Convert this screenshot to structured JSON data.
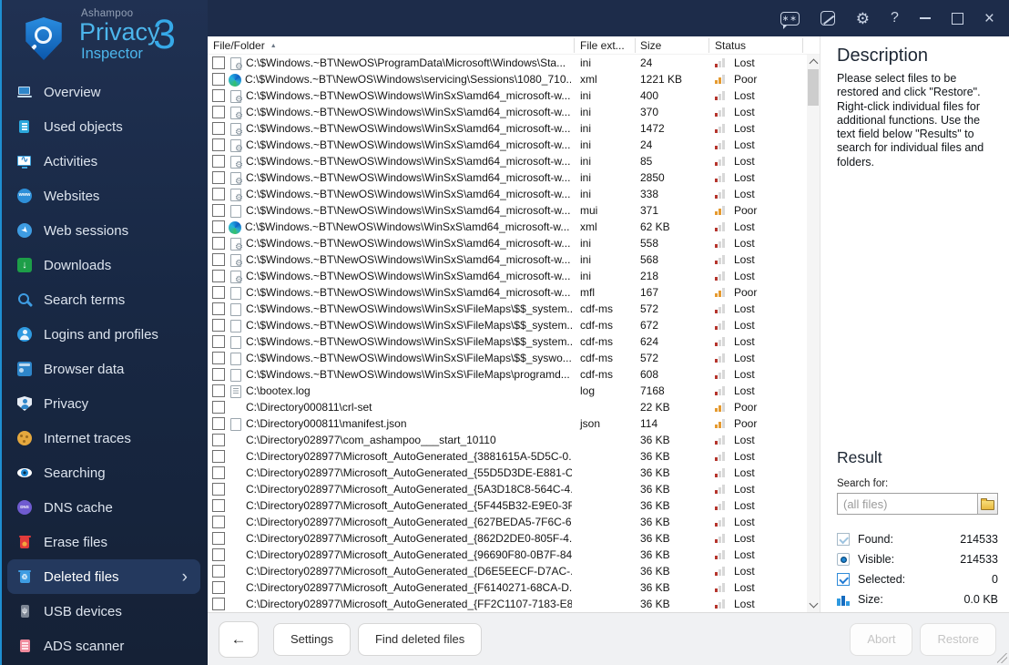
{
  "app": {
    "brand": "Ashampoo",
    "name_line1": "Privacy",
    "name_line2": "Inspector",
    "version": "3"
  },
  "colors": {
    "accent": "#36a9e8",
    "titlebar_bg": "#1d2c4a",
    "sidebar_bg": "#182844",
    "selected_item_bg": "#24395e",
    "status_lost": "#b5342c",
    "status_poor": "#e59a2f"
  },
  "titlebar": {
    "chat_glyph": "∗∗",
    "help_glyph": "?",
    "close_glyph": "×"
  },
  "sidebar": {
    "items": [
      {
        "label": "Overview",
        "icon": "ic-overview",
        "glyph": ""
      },
      {
        "label": "Used objects",
        "icon": "ic-used",
        "glyph": ""
      },
      {
        "label": "Activities",
        "icon": "ic-activities",
        "glyph": "∿"
      },
      {
        "label": "Websites",
        "icon": "ic-websites",
        "glyph": "www"
      },
      {
        "label": "Web sessions",
        "icon": "ic-websessions",
        "glyph": "➤"
      },
      {
        "label": "Downloads",
        "icon": "ic-downloads",
        "glyph": "↓"
      },
      {
        "label": "Search terms",
        "icon": "ic-search",
        "glyph": ""
      },
      {
        "label": "Logins and profiles",
        "icon": "ic-logins",
        "glyph": ""
      },
      {
        "label": "Browser data",
        "icon": "ic-browser",
        "glyph": ""
      },
      {
        "label": "Privacy",
        "icon": "ic-privacy",
        "glyph": ""
      },
      {
        "label": "Internet traces",
        "icon": "ic-traces",
        "glyph": ""
      },
      {
        "label": "Searching",
        "icon": "ic-eye",
        "glyph": ""
      },
      {
        "label": "DNS cache",
        "icon": "ic-dns",
        "glyph": "DNS"
      },
      {
        "label": "Erase files",
        "icon": "ic-erase",
        "glyph": ""
      },
      {
        "label": "Deleted files",
        "icon": "ic-deleted",
        "glyph": "♲",
        "state": "selected",
        "chevron": "›"
      },
      {
        "label": "USB devices",
        "icon": "ic-usb",
        "glyph": "ψ"
      },
      {
        "label": "ADS scanner",
        "icon": "ic-ads",
        "glyph": ""
      }
    ]
  },
  "table": {
    "columns": {
      "file": "File/Folder",
      "ext": "File ext...",
      "size": "Size",
      "status": "Status"
    },
    "sort_indicator": "▲",
    "rows": [
      {
        "path": "C:\\$Windows.~BT\\NewOS\\ProgramData\\Microsoft\\Windows\\Sta...",
        "ext": "ini",
        "size": "24",
        "status": "Lost",
        "icon": "gear"
      },
      {
        "path": "C:\\$Windows.~BT\\NewOS\\Windows\\servicing\\Sessions\\1080_710...",
        "ext": "xml",
        "size": "1221 KB",
        "status": "Poor",
        "icon": "edge"
      },
      {
        "path": "C:\\$Windows.~BT\\NewOS\\Windows\\WinSxS\\amd64_microsoft-w...",
        "ext": "ini",
        "size": "400",
        "status": "Lost",
        "icon": "gear"
      },
      {
        "path": "C:\\$Windows.~BT\\NewOS\\Windows\\WinSxS\\amd64_microsoft-w...",
        "ext": "ini",
        "size": "370",
        "status": "Lost",
        "icon": "gear"
      },
      {
        "path": "C:\\$Windows.~BT\\NewOS\\Windows\\WinSxS\\amd64_microsoft-w...",
        "ext": "ini",
        "size": "1472",
        "status": "Lost",
        "icon": "gear"
      },
      {
        "path": "C:\\$Windows.~BT\\NewOS\\Windows\\WinSxS\\amd64_microsoft-w...",
        "ext": "ini",
        "size": "24",
        "status": "Lost",
        "icon": "gear"
      },
      {
        "path": "C:\\$Windows.~BT\\NewOS\\Windows\\WinSxS\\amd64_microsoft-w...",
        "ext": "ini",
        "size": "85",
        "status": "Lost",
        "icon": "gear"
      },
      {
        "path": "C:\\$Windows.~BT\\NewOS\\Windows\\WinSxS\\amd64_microsoft-w...",
        "ext": "ini",
        "size": "2850",
        "status": "Lost",
        "icon": "gear"
      },
      {
        "path": "C:\\$Windows.~BT\\NewOS\\Windows\\WinSxS\\amd64_microsoft-w...",
        "ext": "ini",
        "size": "338",
        "status": "Lost",
        "icon": "gear"
      },
      {
        "path": "C:\\$Windows.~BT\\NewOS\\Windows\\WinSxS\\amd64_microsoft-w...",
        "ext": "mui",
        "size": "371",
        "status": "Poor",
        "icon": "doc"
      },
      {
        "path": "C:\\$Windows.~BT\\NewOS\\Windows\\WinSxS\\amd64_microsoft-w...",
        "ext": "xml",
        "size": "62 KB",
        "status": "Lost",
        "icon": "edge"
      },
      {
        "path": "C:\\$Windows.~BT\\NewOS\\Windows\\WinSxS\\amd64_microsoft-w...",
        "ext": "ini",
        "size": "558",
        "status": "Lost",
        "icon": "gear"
      },
      {
        "path": "C:\\$Windows.~BT\\NewOS\\Windows\\WinSxS\\amd64_microsoft-w...",
        "ext": "ini",
        "size": "568",
        "status": "Lost",
        "icon": "gear"
      },
      {
        "path": "C:\\$Windows.~BT\\NewOS\\Windows\\WinSxS\\amd64_microsoft-w...",
        "ext": "ini",
        "size": "218",
        "status": "Lost",
        "icon": "gear"
      },
      {
        "path": "C:\\$Windows.~BT\\NewOS\\Windows\\WinSxS\\amd64_microsoft-w...",
        "ext": "mfl",
        "size": "167",
        "status": "Poor",
        "icon": "doc"
      },
      {
        "path": "C:\\$Windows.~BT\\NewOS\\Windows\\WinSxS\\FileMaps\\$$_system...",
        "ext": "cdf-ms",
        "size": "572",
        "status": "Lost",
        "icon": "doc"
      },
      {
        "path": "C:\\$Windows.~BT\\NewOS\\Windows\\WinSxS\\FileMaps\\$$_system...",
        "ext": "cdf-ms",
        "size": "672",
        "status": "Lost",
        "icon": "doc"
      },
      {
        "path": "C:\\$Windows.~BT\\NewOS\\Windows\\WinSxS\\FileMaps\\$$_system...",
        "ext": "cdf-ms",
        "size": "624",
        "status": "Lost",
        "icon": "doc"
      },
      {
        "path": "C:\\$Windows.~BT\\NewOS\\Windows\\WinSxS\\FileMaps\\$$_syswo...",
        "ext": "cdf-ms",
        "size": "572",
        "status": "Lost",
        "icon": "doc"
      },
      {
        "path": "C:\\$Windows.~BT\\NewOS\\Windows\\WinSxS\\FileMaps\\programd...",
        "ext": "cdf-ms",
        "size": "608",
        "status": "Lost",
        "icon": "doc"
      },
      {
        "path": "C:\\bootex.log",
        "ext": "log",
        "size": "7168",
        "status": "Lost",
        "icon": "doclines"
      },
      {
        "path": "C:\\Directory000811\\crl-set",
        "ext": "",
        "size": "22 KB",
        "status": "Poor",
        "icon": "none"
      },
      {
        "path": "C:\\Directory000811\\manifest.json",
        "ext": "json",
        "size": "114",
        "status": "Poor",
        "icon": "doc"
      },
      {
        "path": "C:\\Directory028977\\com_ashampoo___start_10110",
        "ext": "",
        "size": "36 KB",
        "status": "Lost",
        "icon": "none"
      },
      {
        "path": "C:\\Directory028977\\Microsoft_AutoGenerated_{3881615A-5D5C-0...",
        "ext": "",
        "size": "36 KB",
        "status": "Lost",
        "icon": "none"
      },
      {
        "path": "C:\\Directory028977\\Microsoft_AutoGenerated_{55D5D3DE-E881-C...",
        "ext": "",
        "size": "36 KB",
        "status": "Lost",
        "icon": "none"
      },
      {
        "path": "C:\\Directory028977\\Microsoft_AutoGenerated_{5A3D18C8-564C-4...",
        "ext": "",
        "size": "36 KB",
        "status": "Lost",
        "icon": "none"
      },
      {
        "path": "C:\\Directory028977\\Microsoft_AutoGenerated_{5F445B32-E9E0-3F...",
        "ext": "",
        "size": "36 KB",
        "status": "Lost",
        "icon": "none"
      },
      {
        "path": "C:\\Directory028977\\Microsoft_AutoGenerated_{627BEDA5-7F6C-6...",
        "ext": "",
        "size": "36 KB",
        "status": "Lost",
        "icon": "none"
      },
      {
        "path": "C:\\Directory028977\\Microsoft_AutoGenerated_{862D2DE0-805F-4...",
        "ext": "",
        "size": "36 KB",
        "status": "Lost",
        "icon": "none"
      },
      {
        "path": "C:\\Directory028977\\Microsoft_AutoGenerated_{96690F80-0B7F-84...",
        "ext": "",
        "size": "36 KB",
        "status": "Lost",
        "icon": "none"
      },
      {
        "path": "C:\\Directory028977\\Microsoft_AutoGenerated_{D6E5EECF-D7AC-...",
        "ext": "",
        "size": "36 KB",
        "status": "Lost",
        "icon": "none"
      },
      {
        "path": "C:\\Directory028977\\Microsoft_AutoGenerated_{F6140271-68CA-D...",
        "ext": "",
        "size": "36 KB",
        "status": "Lost",
        "icon": "none"
      },
      {
        "path": "C:\\Directory028977\\Microsoft_AutoGenerated_{FF2C1107-7183-E8...",
        "ext": "",
        "size": "36 KB",
        "status": "Lost",
        "icon": "none"
      }
    ]
  },
  "description": {
    "title": "Description",
    "body": "Please select files to be restored and click \"Restore\". Right-click individual files for additional functions. Use the text field below \"Results\" to search for individual files and folders."
  },
  "result": {
    "title": "Result",
    "search_label": "Search for:",
    "search_placeholder": "(all files)",
    "stats": [
      {
        "label": "Found:",
        "value": "214533",
        "icon": "ric-found"
      },
      {
        "label": "Visible:",
        "value": "214533",
        "icon": "ric-visible"
      },
      {
        "label": "Selected:",
        "value": "0",
        "icon": "ric-selected"
      },
      {
        "label": "Size:",
        "value": "0.0 KB",
        "icon": "ric-size"
      }
    ]
  },
  "footer": {
    "back": "←",
    "settings": "Settings",
    "find": "Find deleted files",
    "abort": "Abort",
    "restore": "Restore"
  }
}
